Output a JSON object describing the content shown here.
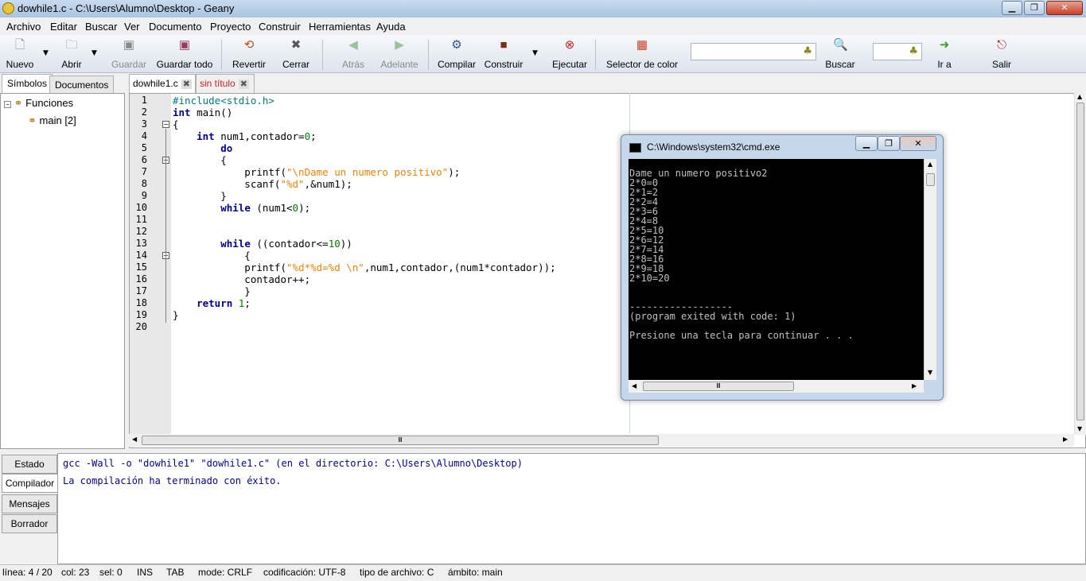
{
  "window": {
    "title": "dowhile1.c - C:\\Users\\Alumno\\Desktop - Geany"
  },
  "menu": [
    "Archivo",
    "Editar",
    "Buscar",
    "Ver",
    "Documento",
    "Proyecto",
    "Construir",
    "Herramientas",
    "Ayuda"
  ],
  "toolbar": {
    "nuevo": "Nuevo",
    "abrir": "Abrir",
    "guardar": "Guardar",
    "guardar_todo": "Guardar todo",
    "revertir": "Revertir",
    "cerrar": "Cerrar",
    "atras": "Atrás",
    "adelante": "Adelante",
    "compilar": "Compilar",
    "construir": "Construir",
    "ejecutar": "Ejecutar",
    "selector": "Selector de color",
    "buscar": "Buscar",
    "ira": "Ir a",
    "salir": "Salir"
  },
  "sidebar": {
    "tab_symbols": "Símbolos",
    "tab_documents": "Documentos",
    "tree_root": "Funciones",
    "tree_item": "main [2]"
  },
  "tabs": {
    "active": "dowhile1.c",
    "other": "sin título"
  },
  "editor": {
    "line_numbers": [
      "1",
      "2",
      "3",
      "4",
      "5",
      "6",
      "7",
      "8",
      "9",
      "10",
      "11",
      "12",
      "13",
      "14",
      "15",
      "16",
      "17",
      "18",
      "19",
      "20"
    ]
  },
  "cmd": {
    "title": "C:\\Windows\\system32\\cmd.exe",
    "lines": [
      "",
      "Dame un numero positivo2",
      "2*0=0",
      "2*1=2",
      "2*2=4",
      "2*3=6",
      "2*4=8",
      "2*5=10",
      "2*6=12",
      "2*7=14",
      "2*8=16",
      "2*9=18",
      "2*10=20",
      "",
      "",
      "------------------",
      "(program exited with code: 1)",
      "",
      "Presione una tecla para continuar . . ."
    ]
  },
  "messages": {
    "tabs": [
      "Estado",
      "Compilador",
      "Mensajes",
      "Borrador"
    ],
    "line1": "gcc -Wall -o \"dowhile1\" \"dowhile1.c\" (en el directorio: C:\\Users\\Alumno\\Desktop)",
    "line2": "La compilación ha terminado con éxito."
  },
  "status": {
    "line": "línea: 4 / 20",
    "col": "col: 23",
    "sel": "sel: 0",
    "ins": "INS",
    "tab": "TAB",
    "mode": "mode: CRLF",
    "enc": "codificación: UTF-8",
    "type": "tipo de archivo: C",
    "scope": "ámbito: main"
  },
  "colors": {
    "keyword": "#00009b",
    "string": "#ff8000",
    "number": "#007f00",
    "preprocessor": "#007f7f",
    "console_bg": "#000000",
    "console_text": "#c0c0c0"
  }
}
